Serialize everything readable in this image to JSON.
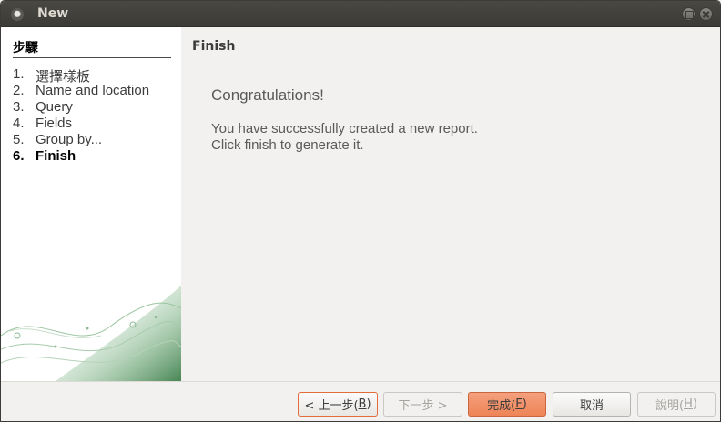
{
  "window": {
    "title": "New"
  },
  "steps": {
    "heading": "步驟",
    "items": [
      {
        "num": "1.",
        "label": "選擇樣板"
      },
      {
        "num": "2.",
        "label": "Name and location"
      },
      {
        "num": "3.",
        "label": "Query"
      },
      {
        "num": "4.",
        "label": "Fields"
      },
      {
        "num": "5.",
        "label": "Group by..."
      },
      {
        "num": "6.",
        "label": "Finish"
      }
    ],
    "current_index": 5
  },
  "content": {
    "heading": "Finish",
    "congrats": "Congratulations!",
    "message_line1": "You have successfully created a new report.",
    "message_line2": "Click finish to generate it."
  },
  "buttons": {
    "back": {
      "text": "< 上一步(",
      "mnemonic": "B",
      "suffix": ")",
      "enabled": true
    },
    "next": {
      "text": "下一步 >",
      "enabled": false
    },
    "finish": {
      "text": "完成(",
      "mnemonic": "F",
      "suffix": ")",
      "enabled": true
    },
    "cancel": {
      "text": "取消",
      "enabled": true
    },
    "help": {
      "text": "說明(",
      "mnemonic": "H",
      "suffix": ")",
      "enabled": false
    }
  },
  "colors": {
    "accent_orange": "#ee8456",
    "title_bar": "#3c3b37",
    "decor_green": "#4f8e5a"
  }
}
